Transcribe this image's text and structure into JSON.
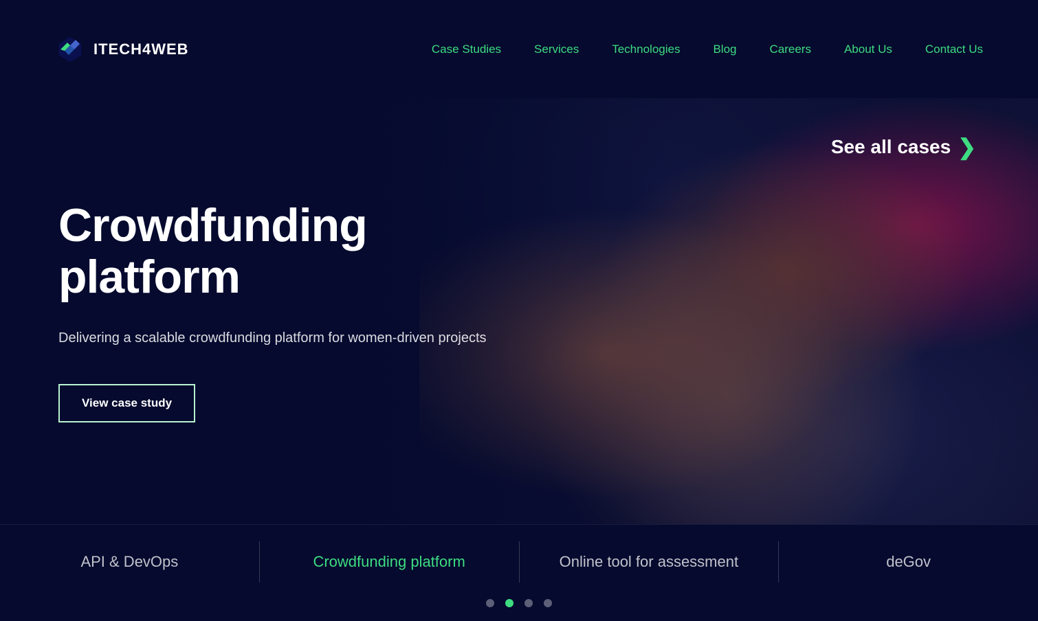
{
  "header": {
    "logo_text": "ITECH4WEB",
    "nav_items": [
      {
        "label": "Case Studies",
        "id": "case-studies"
      },
      {
        "label": "Services",
        "id": "services"
      },
      {
        "label": "Technologies",
        "id": "technologies"
      },
      {
        "label": "Blog",
        "id": "blog"
      },
      {
        "label": "Careers",
        "id": "careers"
      },
      {
        "label": "About Us",
        "id": "about-us"
      },
      {
        "label": "Contact Us",
        "id": "contact-us"
      }
    ]
  },
  "hero": {
    "see_all_label": "See all cases",
    "title": "Crowdfunding platform",
    "subtitle": "Delivering a scalable crowdfunding platform for women-driven projects",
    "cta_label": "View case study"
  },
  "bottom_nav": {
    "items": [
      {
        "label": "API & DevOps",
        "active": false
      },
      {
        "label": "Crowdfunding platform",
        "active": true
      },
      {
        "label": "Online tool for assessment",
        "active": false
      },
      {
        "label": "deGov",
        "active": false
      }
    ]
  },
  "dots": [
    {
      "active": false
    },
    {
      "active": true
    },
    {
      "active": false
    },
    {
      "active": false
    }
  ],
  "colors": {
    "accent": "#3edc81",
    "bg_dark": "#050a2e",
    "text_white": "#ffffff"
  }
}
